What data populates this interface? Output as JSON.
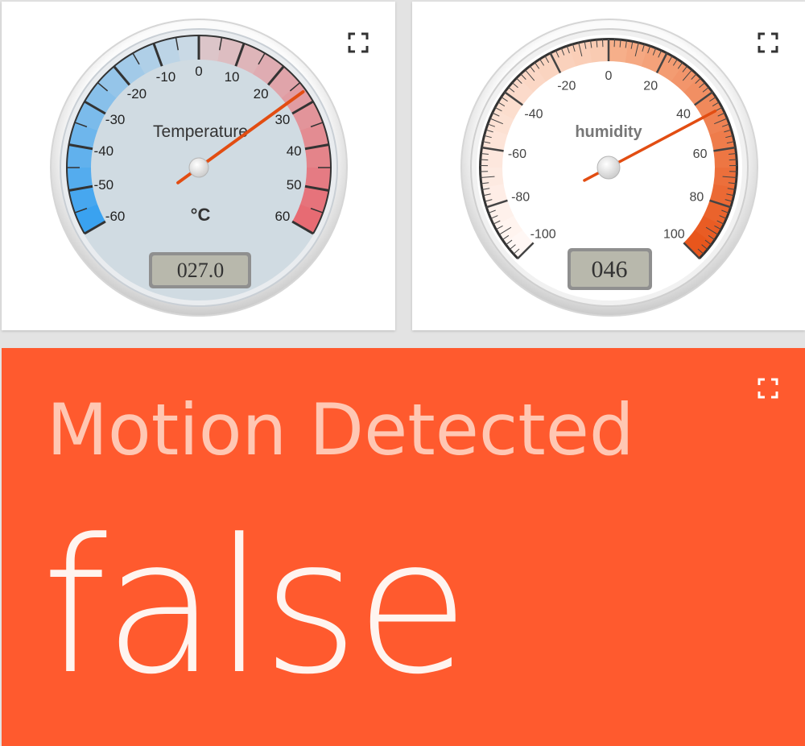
{
  "temperature_gauge": {
    "title": "Temperature",
    "unit": "°C",
    "min": -60,
    "max": 60,
    "ticks": [
      "-60",
      "-50",
      "-40",
      "-30",
      "-20",
      "-10",
      "0",
      "10",
      "20",
      "30",
      "40",
      "50",
      "60"
    ],
    "value": 27.0,
    "display": "027.0",
    "icon": "expand-icon"
  },
  "humidity_gauge": {
    "title": "humidity",
    "min": -100,
    "max": 100,
    "ticks": [
      "-100",
      "-80",
      "-60",
      "-40",
      "-20",
      "0",
      "20",
      "40",
      "60",
      "80",
      "100"
    ],
    "value": 46,
    "display": "046",
    "icon": "expand-icon"
  },
  "motion_widget": {
    "title": "Motion Detected",
    "value": "false",
    "background": "#ff5a2e",
    "icon": "expand-icon"
  }
}
